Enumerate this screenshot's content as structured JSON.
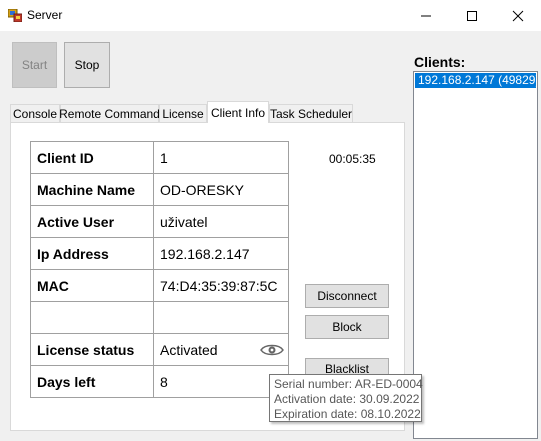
{
  "window": {
    "title": "Server",
    "minimize_glyph": "—",
    "maximize_glyph": "☐",
    "close_glyph": "✕"
  },
  "toolbar": {
    "start_label": "Start",
    "start_enabled": false,
    "stop_label": "Stop"
  },
  "tabs": [
    {
      "label": "Console"
    },
    {
      "label": "Remote Command"
    },
    {
      "label": "License"
    },
    {
      "label": "Client Info",
      "active": true
    },
    {
      "label": "Task Scheduler"
    }
  ],
  "client_info": {
    "rows": [
      {
        "key": "Client ID",
        "value": "1"
      },
      {
        "key": "Machine Name",
        "value": "OD-ORESKY"
      },
      {
        "key": "Active User",
        "value": "uživatel"
      },
      {
        "key": "Ip Address",
        "value": "192.168.2.147"
      },
      {
        "key": "MAC",
        "value": "74:D4:35:39:87:5C"
      },
      {
        "key": "",
        "value": ""
      },
      {
        "key": "License status",
        "value": "Activated"
      },
      {
        "key": "Days left",
        "value": "8"
      }
    ],
    "uptime": "00:05:35",
    "disconnect_label": "Disconnect",
    "block_label": "Block",
    "blacklist_label": "Blacklist"
  },
  "tooltip": {
    "serial_line": "Serial number: AR-ED-0004",
    "activation_line": "Activation date: 30.09.2022",
    "expiration_line": "Expiration date: 08.10.2022"
  },
  "clients": {
    "label": "Clients:",
    "items": [
      {
        "text": "192.168.2.147 (49829)",
        "selected": true
      }
    ]
  },
  "colors": {
    "selection": "#0078d7",
    "window_bg": "#f0f0f0"
  },
  "icons": {
    "app": "server-app-icon",
    "license_view": "eye-icon"
  }
}
